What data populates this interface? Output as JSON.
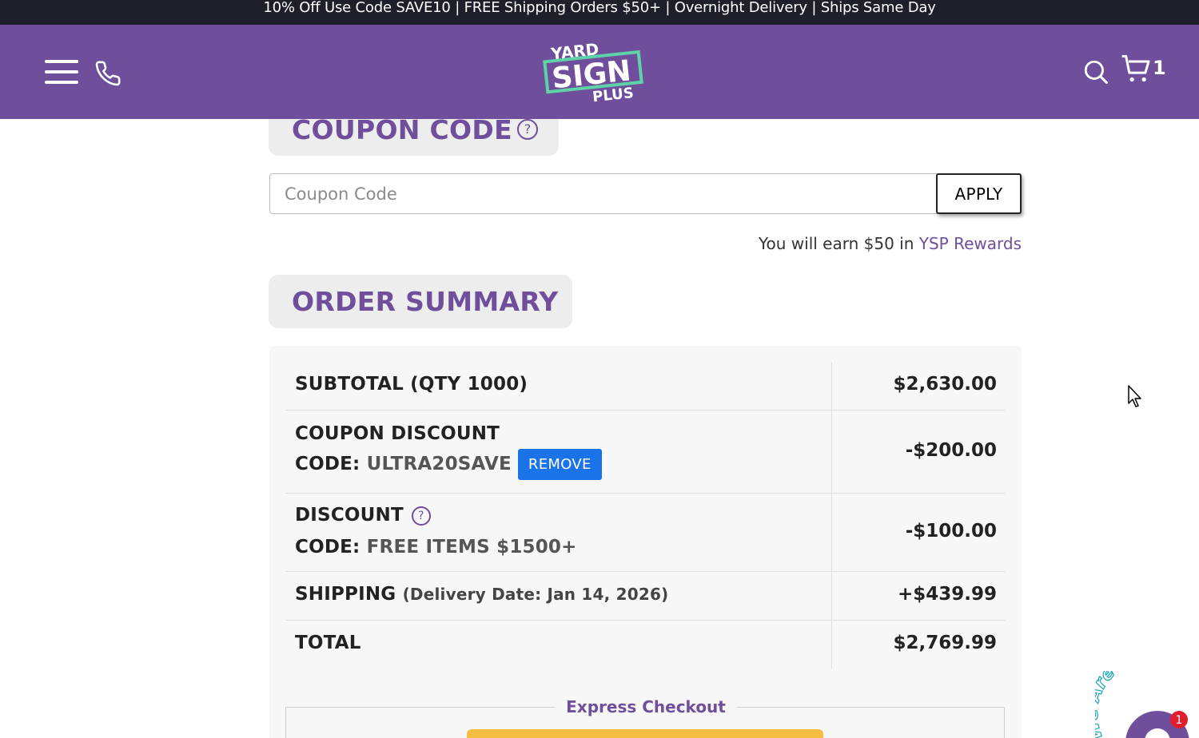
{
  "promo": {
    "text": "10% Off Use Code SAVE10 | FREE Shipping Orders $50+ | Overnight Delivery | Ships Same Day"
  },
  "header": {
    "logo_top": "YARD",
    "logo_main": "SIGN",
    "logo_bottom": "PLUS",
    "cart_count": "1",
    "colors": {
      "brand": "#6f4f9b",
      "logo_green": "#5fd3a8"
    }
  },
  "coupon": {
    "title": "COUPON CODE",
    "help_glyph": "?",
    "placeholder": "Coupon Code",
    "apply_label": "APPLY",
    "rewards_prefix": "You will earn $50 in ",
    "rewards_link": "YSP Rewards"
  },
  "summary": {
    "title": "ORDER SUMMARY",
    "subtotal_label": "SUBTOTAL (QTY 1000)",
    "subtotal_value": "$2,630.00",
    "coupon_label": "COUPON DISCOUNT",
    "coupon_code_prefix": "CODE: ",
    "coupon_code": "ULTRA20SAVE",
    "remove_label": "REMOVE",
    "coupon_value": "-$200.00",
    "discount_label": "DISCOUNT",
    "discount_help": "?",
    "discount_code_prefix": "CODE: ",
    "discount_code": "FREE ITEMS $1500+",
    "discount_value": "-$100.00",
    "shipping_label": "SHIPPING",
    "shipping_note": "(Delivery Date: Jan 14, 2026)",
    "shipping_value": "+$439.99",
    "total_label": "TOTAL",
    "total_value": "$2,769.99",
    "express_label": "Express Checkout"
  },
  "chat": {
    "text": "We Are Here",
    "badge": "1"
  }
}
